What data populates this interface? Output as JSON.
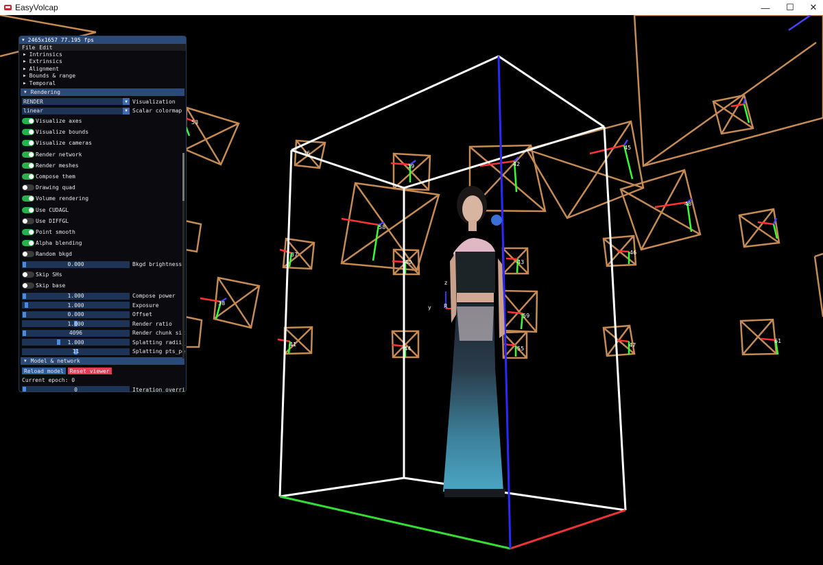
{
  "window": {
    "title": "EasyVolcap",
    "controls": [
      "—",
      "☐",
      "✕"
    ]
  },
  "panel": {
    "title": "2465x1657 77.195 fps",
    "menu": [
      "File",
      "Edit"
    ],
    "tree_items": [
      "Intrinsics",
      "Extrinsics",
      "Alignment",
      "Bounds & range",
      "Temporal"
    ],
    "rendering_label": "Rendering",
    "visualization": {
      "value": "RENDER",
      "label": "Visualization"
    },
    "colormap": {
      "value": "linear",
      "label": "Scalar colormap"
    },
    "toggles_a": [
      {
        "label": "Visualize axes",
        "on": true
      },
      {
        "label": "Visualize bounds",
        "on": true
      },
      {
        "label": "Visualize cameras",
        "on": true
      },
      {
        "label": "Render network",
        "on": true
      },
      {
        "label": "Render meshes",
        "on": true
      },
      {
        "label": "Compose them",
        "on": true
      },
      {
        "label": "Drawing quad",
        "on": false
      },
      {
        "label": "Volume rendering",
        "on": true
      },
      {
        "label": "Use CUDAGL",
        "on": true
      },
      {
        "label": "Use DIFFGL",
        "on": false
      },
      {
        "label": "Point smooth",
        "on": true
      },
      {
        "label": "Alpha blending",
        "on": true
      },
      {
        "label": "Random bkgd",
        "on": false
      }
    ],
    "bkgd": {
      "value": "0.000",
      "label": "Bkgd brightness"
    },
    "toggles_b": [
      {
        "label": "Skip SHs",
        "on": false
      },
      {
        "label": "Skip base",
        "on": false
      }
    ],
    "sliders": [
      {
        "value": "1.000",
        "label": "Compose power",
        "fraction": 0.0
      },
      {
        "value": "1.000",
        "label": "Exposure",
        "fraction": 0.02
      },
      {
        "value": "0.000",
        "label": "Offset",
        "fraction": 0.0
      },
      {
        "value": "1.000",
        "label": "Render ratio",
        "fraction": 0.5
      },
      {
        "value": "4096",
        "label": "Render chunk siz",
        "fraction": 0.0
      },
      {
        "value": "1.000",
        "label": "Splatting radii_",
        "fraction": 0.33
      },
      {
        "value": "11",
        "label": "Splatting pts_pe",
        "fraction": 0.5
      }
    ],
    "model_label": "Model & network",
    "reload_label": "Reload model",
    "reset_label": "Reset viewer",
    "epoch_label": "Current epoch: 0",
    "iteration": {
      "value": "0",
      "label": "Iteration overri"
    }
  },
  "camera_labels": [
    "53",
    "36",
    "39",
    "42",
    "45",
    "48",
    "58",
    "37",
    "40",
    "43",
    "46",
    "59",
    "38",
    "41",
    "44",
    "47",
    "55",
    "61"
  ],
  "axis_labels": [
    "z",
    "y",
    "R"
  ],
  "colors": {
    "accent": "#2c4a78",
    "toggle_on": "#24b24a",
    "reset": "#e23b52",
    "camera": "#c68a52"
  }
}
